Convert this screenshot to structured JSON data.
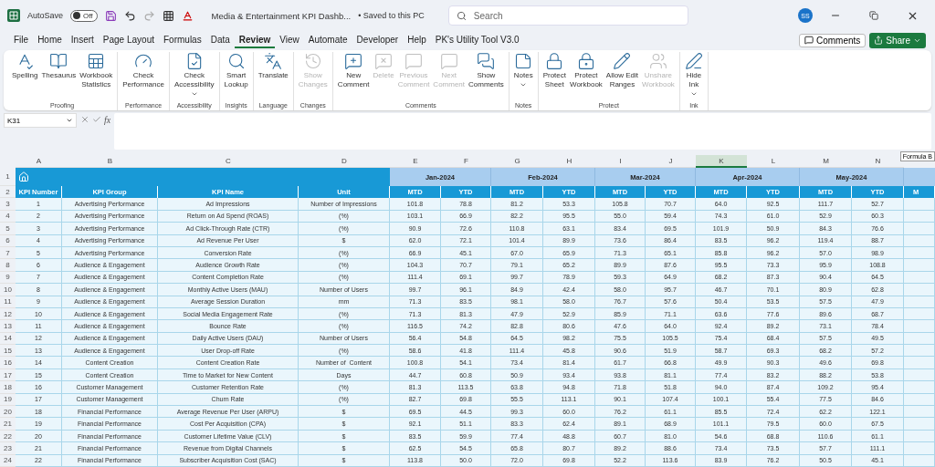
{
  "title_bar": {
    "autosave_label": "AutoSave",
    "autosave": {
      "label": "Off",
      "on": false
    },
    "document_title": "Media & Entertainment KPI Dashb...",
    "save_status": "• Saved to this PC",
    "search": {
      "placeholder": "Search"
    },
    "avatar": "SS"
  },
  "ribbon_tabs": [
    {
      "label": "File",
      "selected": false
    },
    {
      "label": "Home",
      "selected": false
    },
    {
      "label": "Insert",
      "selected": false
    },
    {
      "label": "Page Layout",
      "selected": false
    },
    {
      "label": "Formulas",
      "selected": false
    },
    {
      "label": "Data",
      "selected": false
    },
    {
      "label": "Review",
      "selected": true
    },
    {
      "label": "View",
      "selected": false
    },
    {
      "label": "Automate",
      "selected": false
    },
    {
      "label": "Developer",
      "selected": false
    },
    {
      "label": "Help",
      "selected": false
    },
    {
      "label": "PK's Utility Tool V3.0",
      "selected": false
    }
  ],
  "actions": {
    "comments": "Comments",
    "share": "Share"
  },
  "ribbon_groups": [
    {
      "name": "Proofing",
      "buttons": [
        {
          "label": "Spelling",
          "disabled": false,
          "dropdown": false
        },
        {
          "label": "Thesaurus",
          "disabled": false,
          "dropdown": false
        },
        {
          "label": "Workbook\nStatistics",
          "disabled": false,
          "dropdown": false
        }
      ]
    },
    {
      "name": "Performance",
      "buttons": [
        {
          "label": "Check\nPerformance",
          "disabled": false,
          "dropdown": false
        }
      ]
    },
    {
      "name": "Accessibility",
      "buttons": [
        {
          "label": "Check\nAccessibility",
          "disabled": false,
          "dropdown": true
        }
      ]
    },
    {
      "name": "Insights",
      "buttons": [
        {
          "label": "Smart\nLookup",
          "disabled": false,
          "dropdown": false
        }
      ]
    },
    {
      "name": "Language",
      "buttons": [
        {
          "label": "Translate",
          "disabled": false,
          "dropdown": false
        }
      ]
    },
    {
      "name": "Changes",
      "buttons": [
        {
          "label": "Show\nChanges",
          "disabled": true,
          "dropdown": false
        }
      ]
    },
    {
      "name": "Comments",
      "buttons": [
        {
          "label": "New\nComment",
          "disabled": false,
          "dropdown": false
        },
        {
          "label": "Delete",
          "disabled": true,
          "dropdown": false
        },
        {
          "label": "Previous\nComment",
          "disabled": true,
          "dropdown": false
        },
        {
          "label": "Next\nComment",
          "disabled": true,
          "dropdown": false
        },
        {
          "label": "Show\nComments",
          "disabled": false,
          "dropdown": false
        }
      ]
    },
    {
      "name": "Notes",
      "buttons": [
        {
          "label": "Notes",
          "disabled": false,
          "dropdown": true
        }
      ]
    },
    {
      "name": "Protect",
      "buttons": [
        {
          "label": "Protect\nSheet",
          "disabled": false,
          "dropdown": false
        },
        {
          "label": "Protect\nWorkbook",
          "disabled": false,
          "dropdown": false
        },
        {
          "label": "Allow Edit\nRanges",
          "disabled": false,
          "dropdown": false
        },
        {
          "label": "Unshare\nWorkbook",
          "disabled": true,
          "dropdown": false
        }
      ]
    },
    {
      "name": "Ink",
      "buttons": [
        {
          "label": "Hide\nInk",
          "disabled": false,
          "dropdown": true
        }
      ]
    }
  ],
  "formula_bar": {
    "name_box": "K31",
    "fx": "fx"
  },
  "tooltip": "Formula B",
  "columns": [
    {
      "label": "A",
      "selected": false
    },
    {
      "label": "B",
      "selected": false
    },
    {
      "label": "C",
      "selected": false
    },
    {
      "label": "D",
      "selected": false
    },
    {
      "label": "E",
      "selected": false
    },
    {
      "label": "F",
      "selected": false
    },
    {
      "label": "G",
      "selected": false
    },
    {
      "label": "H",
      "selected": false
    },
    {
      "label": "I",
      "selected": false
    },
    {
      "label": "J",
      "selected": false
    },
    {
      "label": "K",
      "selected": true
    },
    {
      "label": "L",
      "selected": false
    },
    {
      "label": "M",
      "selected": false
    },
    {
      "label": "N",
      "selected": false
    }
  ],
  "row_numbers": [
    "1",
    "2",
    "3",
    "4",
    "5",
    "6",
    "7",
    "8",
    "9",
    "10",
    "11",
    "12",
    "13",
    "14",
    "15",
    "16",
    "17",
    "18",
    "19",
    "20",
    "21",
    "22",
    "23",
    "24"
  ],
  "headers": [
    "KPI Number",
    "KPI Group",
    "KPI Name",
    "Unit"
  ],
  "months": [
    {
      "label": "Jan-2024",
      "subs": [
        "MTD",
        "YTD"
      ]
    },
    {
      "label": "Feb-2024",
      "subs": [
        "MTD",
        "YTD"
      ]
    },
    {
      "label": "Mar-2024",
      "subs": [
        "MTD",
        "YTD"
      ]
    },
    {
      "label": "Apr-2024",
      "subs": [
        "MTD",
        "YTD"
      ]
    },
    {
      "label": "May-2024",
      "subs": [
        "MTD",
        "YTD"
      ]
    }
  ],
  "cut_sub_header": "M",
  "rows": [
    {
      "number": "1",
      "group": "Advertising Performance",
      "name": "Ad Impressions",
      "unit": "Number of Impressions",
      "values": [
        "101.8",
        "78.8",
        "81.2",
        "53.3",
        "105.8",
        "70.7",
        "64.0",
        "92.5",
        "111.7",
        "52.7"
      ]
    },
    {
      "number": "2",
      "group": "Advertising Performance",
      "name": "Return on Ad Spend (ROAS)",
      "unit": "(%)",
      "values": [
        "103.1",
        "66.9",
        "82.2",
        "95.5",
        "55.0",
        "59.4",
        "74.3",
        "61.0",
        "52.9",
        "60.3"
      ]
    },
    {
      "number": "3",
      "group": "Advertising Performance",
      "name": "Ad Click-Through Rate (CTR)",
      "unit": "(%)",
      "values": [
        "90.9",
        "72.6",
        "110.8",
        "63.1",
        "83.4",
        "69.5",
        "101.9",
        "50.9",
        "84.3",
        "76.6"
      ]
    },
    {
      "number": "4",
      "group": "Advertising Performance",
      "name": "Ad Revenue Per User",
      "unit": "$",
      "values": [
        "62.0",
        "72.1",
        "101.4",
        "89.9",
        "73.6",
        "86.4",
        "83.5",
        "96.2",
        "119.4",
        "88.7"
      ]
    },
    {
      "number": "5",
      "group": "Advertising Performance",
      "name": "Conversion Rate",
      "unit": "(%)",
      "values": [
        "66.9",
        "45.1",
        "67.0",
        "65.9",
        "71.3",
        "65.1",
        "85.8",
        "96.2",
        "57.0",
        "98.9"
      ]
    },
    {
      "number": "6",
      "group": "Audience & Engagement",
      "name": "Audience Growth Rate",
      "unit": "(%)",
      "values": [
        "104.3",
        "70.7",
        "79.1",
        "65.2",
        "89.9",
        "87.6",
        "95.5",
        "73.3",
        "95.9",
        "108.8"
      ]
    },
    {
      "number": "7",
      "group": "Audience & Engagement",
      "name": "Content Completion Rate",
      "unit": "(%)",
      "values": [
        "111.4",
        "69.1",
        "99.7",
        "78.9",
        "59.3",
        "64.9",
        "68.2",
        "87.3",
        "90.4",
        "64.5"
      ]
    },
    {
      "number": "8",
      "group": "Audience & Engagement",
      "name": "Monthly Active Users (MAU)",
      "unit": "Number of Users",
      "values": [
        "99.7",
        "96.1",
        "84.9",
        "42.4",
        "58.0",
        "95.7",
        "46.7",
        "70.1",
        "80.9",
        "62.8"
      ]
    },
    {
      "number": "9",
      "group": "Audience & Engagement",
      "name": "Average Session Duration",
      "unit": "mm",
      "values": [
        "71.3",
        "83.5",
        "98.1",
        "58.0",
        "76.7",
        "57.6",
        "50.4",
        "53.5",
        "57.5",
        "47.9"
      ]
    },
    {
      "number": "10",
      "group": "Audience & Engagement",
      "name": "Social Media Engagement Rate",
      "unit": "(%)",
      "values": [
        "71.3",
        "81.3",
        "47.9",
        "52.9",
        "85.9",
        "71.1",
        "63.6",
        "77.6",
        "89.6",
        "68.7"
      ]
    },
    {
      "number": "11",
      "group": "Audience & Engagement",
      "name": "Bounce Rate",
      "unit": "(%)",
      "values": [
        "116.5",
        "74.2",
        "82.8",
        "80.6",
        "47.6",
        "64.0",
        "92.4",
        "89.2",
        "73.1",
        "78.4"
      ]
    },
    {
      "number": "12",
      "group": "Audience & Engagement",
      "name": "Daily Active Users (DAU)",
      "unit": "Number of Users",
      "values": [
        "56.4",
        "54.8",
        "64.5",
        "98.2",
        "75.5",
        "105.5",
        "75.4",
        "68.4",
        "57.5",
        "49.5"
      ]
    },
    {
      "number": "13",
      "group": "Audience & Engagement",
      "name": "User Drop-off Rate",
      "unit": "(%)",
      "values": [
        "58.6",
        "41.8",
        "111.4",
        "45.8",
        "90.6",
        "51.9",
        "58.7",
        "69.3",
        "68.2",
        "57.2"
      ]
    },
    {
      "number": "14",
      "group": "Content Creation",
      "name": "Content Creation Rate",
      "unit": "Number of  Content",
      "values": [
        "100.8",
        "54.1",
        "73.4",
        "81.4",
        "61.7",
        "66.8",
        "49.9",
        "90.3",
        "49.6",
        "69.8"
      ]
    },
    {
      "number": "15",
      "group": "Content Creation",
      "name": "Time to Market for New Content",
      "unit": "Days",
      "values": [
        "44.7",
        "60.8",
        "50.9",
        "93.4",
        "93.8",
        "81.1",
        "77.4",
        "83.2",
        "88.2",
        "53.8"
      ]
    },
    {
      "number": "16",
      "group": "Customer Management",
      "name": "Customer Retention Rate",
      "unit": "(%)",
      "values": [
        "81.3",
        "113.5",
        "63.8",
        "94.8",
        "71.8",
        "51.8",
        "94.0",
        "87.4",
        "109.2",
        "95.4"
      ]
    },
    {
      "number": "17",
      "group": "Customer Management",
      "name": "Churn Rate",
      "unit": "(%)",
      "values": [
        "82.7",
        "69.8",
        "55.5",
        "113.1",
        "90.1",
        "107.4",
        "100.1",
        "55.4",
        "77.5",
        "84.6"
      ]
    },
    {
      "number": "18",
      "group": "Financial Performance",
      "name": "Average Revenue Per User (ARPU)",
      "unit": "$",
      "values": [
        "69.5",
        "44.5",
        "99.3",
        "60.0",
        "76.2",
        "61.1",
        "85.5",
        "72.4",
        "62.2",
        "122.1"
      ]
    },
    {
      "number": "19",
      "group": "Financial Performance",
      "name": "Cost Per Acquisition (CPA)",
      "unit": "$",
      "values": [
        "92.1",
        "51.1",
        "83.3",
        "62.4",
        "89.1",
        "68.9",
        "101.1",
        "79.5",
        "60.0",
        "67.5"
      ]
    },
    {
      "number": "20",
      "group": "Financial Performance",
      "name": "Customer Lifetime Value (CLV)",
      "unit": "$",
      "values": [
        "83.5",
        "59.9",
        "77.4",
        "48.8",
        "60.7",
        "81.0",
        "54.6",
        "68.8",
        "110.6",
        "61.1"
      ]
    },
    {
      "number": "21",
      "group": "Financial Performance",
      "name": "Revenue from Digital Channels",
      "unit": "$",
      "values": [
        "62.5",
        "54.5",
        "65.8",
        "80.7",
        "89.2",
        "88.6",
        "73.4",
        "73.5",
        "57.7",
        "111.1"
      ]
    },
    {
      "number": "22",
      "group": "Financial Performance",
      "name": "Subscriber Acquisition Cost (SAC)",
      "unit": "$",
      "values": [
        "113.8",
        "50.0",
        "72.0",
        "69.8",
        "52.2",
        "113.6",
        "83.9",
        "76.2",
        "50.5",
        "45.1"
      ]
    }
  ]
}
